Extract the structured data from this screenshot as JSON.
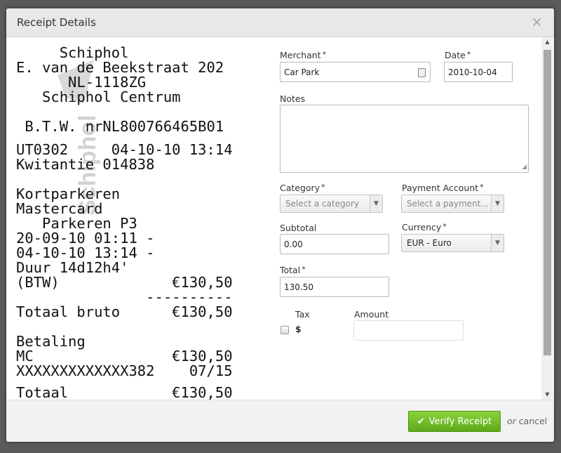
{
  "modal": {
    "title": "Receipt Details",
    "close_label": "×"
  },
  "receipt": {
    "lines": [
      "     Schiphol",
      "E. van de Beekstraat 202",
      "      NL-1118ZG",
      "   Schiphol Centrum",
      "",
      " B.T.W. nrNL800766465B01",
      "",
      "UT0302     04-10-10 13:14",
      "Kwitantie 014838",
      "",
      "Kortparkeren",
      "Mastercard",
      "   Parkeren P3",
      "20-09-10 01:11 -",
      "04-10-10 13:14 -",
      "Duur 14d12h4'",
      "(BTW)             €130,50",
      "               ----------",
      "Totaal bruto      €130,50",
      "",
      "Betaling",
      "MC                €130,50",
      "XXXXXXXXXXXXX382    07/15",
      "Totaal            €130,50"
    ],
    "watermark_text": "Schiphol"
  },
  "form": {
    "merchant": {
      "label": "Merchant",
      "value": "Car Park"
    },
    "date": {
      "label": "Date",
      "value": "2010-10-04"
    },
    "notes": {
      "label": "Notes",
      "value": ""
    },
    "category": {
      "label": "Category",
      "placeholder": "Select a category"
    },
    "payment_account": {
      "label": "Payment Account",
      "placeholder": "Select a payment..."
    },
    "subtotal": {
      "label": "Subtotal",
      "value": "0.00"
    },
    "currency": {
      "label": "Currency",
      "value": "EUR - Euro"
    },
    "total": {
      "label": "Total",
      "value": "130.50"
    },
    "tax": {
      "label": "Tax",
      "symbol": "$"
    },
    "amount": {
      "label": "Amount",
      "value": ""
    },
    "required_marker": "*"
  },
  "footer": {
    "verify_label": "Verify Receipt",
    "or_text": "or",
    "cancel_label": "cancel"
  },
  "colors": {
    "verify_green": "#6cb624",
    "header_bg": "#e8e8e8"
  }
}
